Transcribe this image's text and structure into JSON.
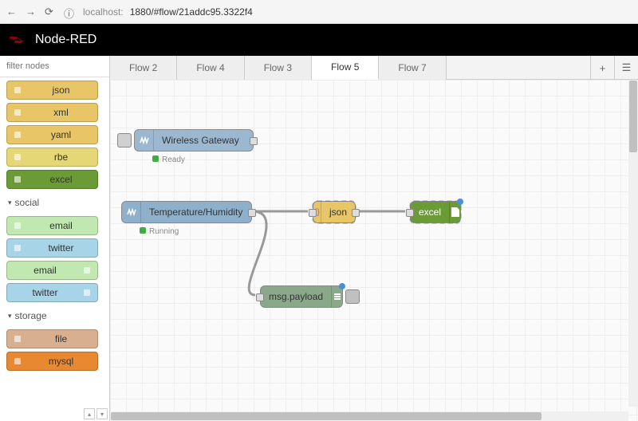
{
  "browser": {
    "url_prefix": "localhost:",
    "url_rest": "1880/#flow/21addc95.3322f4"
  },
  "header": {
    "title": "Node-RED"
  },
  "sidebar": {
    "filter_placeholder": "filter nodes",
    "nodes_top": [
      {
        "label": "json",
        "cls": "node-json"
      },
      {
        "label": "xml",
        "cls": "node-xml"
      },
      {
        "label": "yaml",
        "cls": "node-yaml"
      },
      {
        "label": "rbe",
        "cls": "node-rbe"
      },
      {
        "label": "excel",
        "cls": "node-excel"
      }
    ],
    "cat_social": "social",
    "nodes_social": [
      {
        "label": "email",
        "cls": "node-email-in"
      },
      {
        "label": "twitter",
        "cls": "node-twitter-in"
      },
      {
        "label": "email",
        "cls": "node-email-out"
      },
      {
        "label": "twitter",
        "cls": "node-twitter-out"
      }
    ],
    "cat_storage": "storage",
    "nodes_storage": [
      {
        "label": "file",
        "cls": "node-file"
      },
      {
        "label": "mysql",
        "cls": "node-mysql"
      }
    ]
  },
  "tabs": {
    "items": [
      "Flow 2",
      "Flow 4",
      "Flow 3",
      "Flow 5",
      "Flow 7"
    ],
    "active_index": 3
  },
  "flow": {
    "wireless_gateway": {
      "label": "Wireless Gateway",
      "status": "Ready"
    },
    "temphum": {
      "label": "Temperature/Humidity",
      "status": "Running"
    },
    "json": {
      "label": "json"
    },
    "excel": {
      "label": "excel"
    },
    "debug": {
      "label": "msg.payload"
    }
  }
}
